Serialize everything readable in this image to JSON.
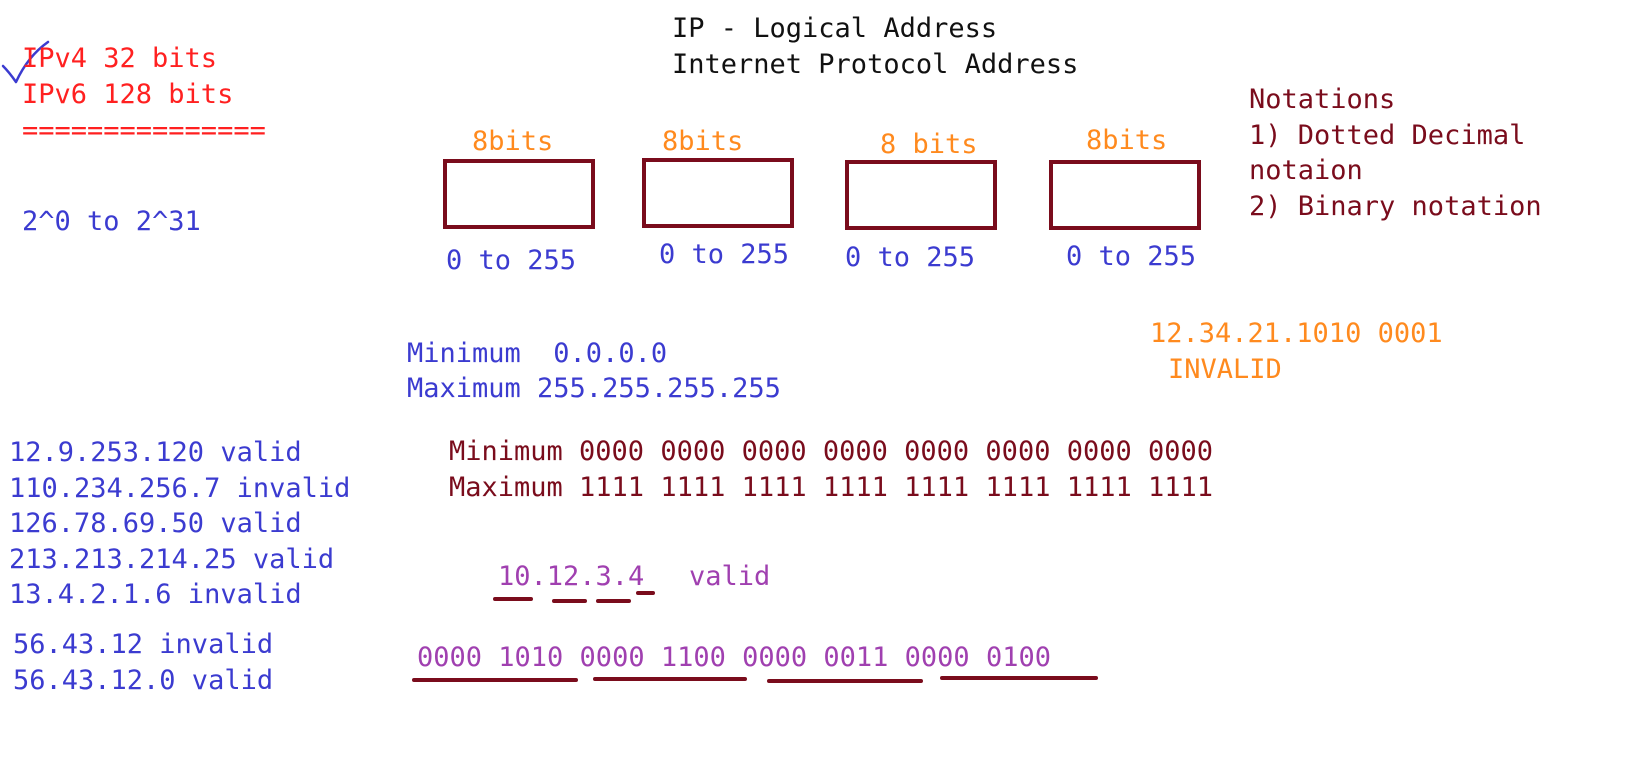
{
  "title": {
    "line1": "IP - Logical Address",
    "line2": "Internet Protocol Address"
  },
  "versions": {
    "ipv4": "IPv4 32 bits",
    "ipv6": "IPv6 128 bits",
    "separator": "==============="
  },
  "range_power": "2^0 to 2^31",
  "octets": [
    {
      "bits": "8bits",
      "range": "0 to 255"
    },
    {
      "bits": "8bits",
      "range": "0 to 255"
    },
    {
      "bits": "8 bits",
      "range": "0 to 255"
    },
    {
      "bits": "8bits",
      "range": "0 to 255"
    }
  ],
  "notations": {
    "heading": "Notations",
    "item1": "1) Dotted Decimal",
    "item1_cont": "notaion",
    "item2": "2) Binary notation"
  },
  "decimal_range": {
    "min": "Minimum  0.0.0.0",
    "max": "Maximum 255.255.255.255"
  },
  "invalid_example": {
    "value": "12.34.21.1010 0001",
    "label": "INVALID"
  },
  "binary_range": {
    "min": "Minimum 0000 0000 0000 0000 0000 0000 0000 0000",
    "max": "Maximum 1111 1111 1111 1111 1111 1111 1111 1111"
  },
  "examples": [
    "12.9.253.120 valid",
    "110.234.256.7 invalid",
    "126.78.69.50 valid",
    "213.213.214.25 valid",
    "13.4.2.1.6 invalid"
  ],
  "examples2": [
    "56.43.12 invalid",
    "56.43.12.0 valid"
  ],
  "conversion": {
    "address": "10.12.3.4",
    "status": "valid",
    "binary": "0000 1010 0000 1100 0000 0011 0000 0100"
  },
  "colors": {
    "black": "#111111",
    "red": "#ff2020",
    "blue": "#3b3bd0",
    "orange": "#ff8a1e",
    "maroon": "#7a0c1c",
    "purple": "#a040b0"
  },
  "icons": [
    "checkmark-icon"
  ]
}
